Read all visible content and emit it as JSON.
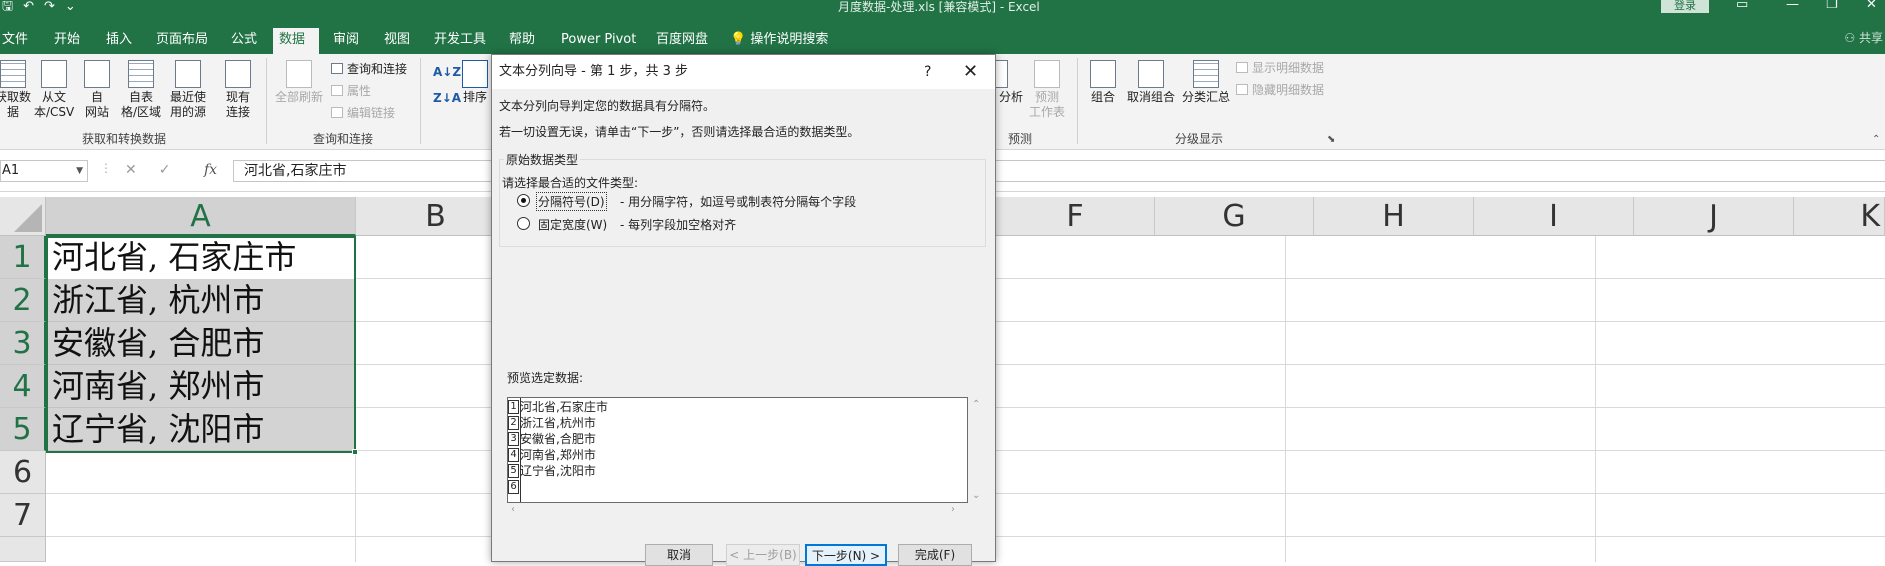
{
  "titlebar": {
    "qat_icons": [
      "save-icon",
      "undo-icon",
      "redo-icon",
      "customize-icon"
    ],
    "document_title": "月度数据-处理.xls  [兼容模式]  -  Excel",
    "login_label": "登录"
  },
  "tabs": {
    "file": "文件",
    "home": "开始",
    "insert": "插入",
    "page_layout": "页面布局",
    "formulas": "公式",
    "data": "数据",
    "review": "审阅",
    "view": "视图",
    "developer": "开发工具",
    "help": "帮助",
    "power_pivot": "Power Pivot",
    "baidu": "百度网盘",
    "tell_me": "操作说明搜索",
    "share": "共享"
  },
  "ribbon": {
    "get_data": "获取数\n据",
    "from_csv": "从文\n本/CSV",
    "from_web": "自\n网站",
    "from_table": "自表\n格/区域",
    "recent_sources": "最近使\n用的源",
    "existing_conn": "现有\n连接",
    "group_get_transform": "获取和转换数据",
    "refresh_all": "全部刷新",
    "queries_conn": "查询和连接",
    "properties": "属性",
    "edit_links": "编辑链接",
    "group_queries": "查询和连接",
    "sort": "排序",
    "what_if": "分析",
    "forecast_sheet": "预测\n工作表",
    "group_forecast": "预测",
    "group_btn": "组合",
    "ungroup": "取消组合",
    "subtotal": "分类汇总",
    "show_detail": "显示明细数据",
    "hide_detail": "隐藏明细数据",
    "group_outline": "分级显示"
  },
  "formula_bar": {
    "name_box": "A1",
    "formula": "河北省,石家庄市"
  },
  "grid": {
    "columns": [
      "A",
      "B",
      "F",
      "G",
      "H",
      "I",
      "J",
      "K"
    ],
    "rows": [
      "1",
      "2",
      "3",
      "4",
      "5",
      "6",
      "7"
    ],
    "cells": [
      "河北省, 石家庄市",
      "浙江省, 杭州市",
      "安徽省, 合肥市",
      "河南省, 郑州市",
      "辽宁省, 沈阳市"
    ]
  },
  "dialog": {
    "title": "文本分列向导 - 第 1 步，共 3 步",
    "help": "?",
    "close": "✕",
    "line1": "文本分列向导判定您的数据具有分隔符。",
    "line2": "若一切设置无误，请单击“下一步”，否则请选择最合适的数据类型。",
    "group_label": "原始数据类型",
    "choose_label": "请选择最合适的文件类型:",
    "option_delimited": "分隔符号(D)",
    "option_delimited_desc": "- 用分隔字符，如逗号或制表符分隔每个字段",
    "option_fixed": "固定宽度(W)",
    "option_fixed_desc": "- 每列字段加空格对齐",
    "preview_label": "预览选定数据:",
    "preview_nums": [
      "1",
      "2",
      "3",
      "4",
      "5",
      "6"
    ],
    "preview_rows": [
      "河北省,石家庄市",
      "浙江省,杭州市",
      "安徽省,合肥市",
      "河南省,郑州市",
      "辽宁省,沈阳市",
      ""
    ],
    "btn_cancel": "取消",
    "btn_back": "< 上一步(B)",
    "btn_next": "下一步(N) >",
    "btn_finish": "完成(F)"
  },
  "colors": {
    "excel_green": "#217346",
    "selection_fill": "#d3d3d3",
    "focus_blue": "#0078d7"
  }
}
